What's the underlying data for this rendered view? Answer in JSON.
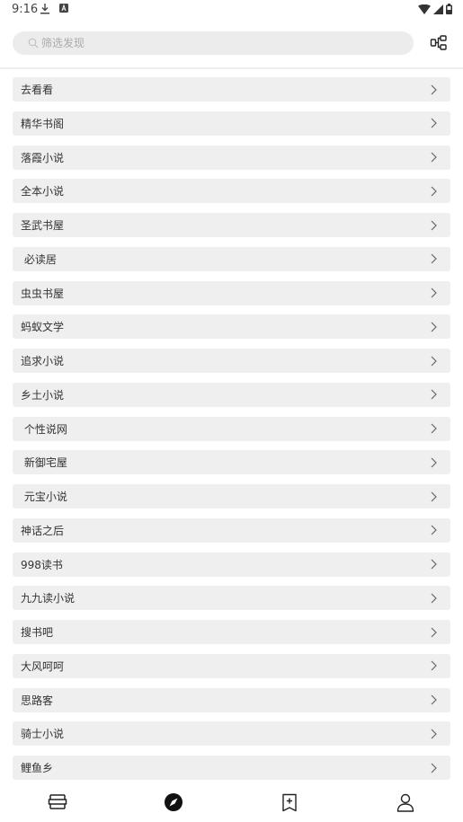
{
  "status_bar": {
    "time": "9:16"
  },
  "search": {
    "placeholder": "筛选发现"
  },
  "sources": [
    {
      "label": "去看看"
    },
    {
      "label": "精华书阁"
    },
    {
      "label": "落霞小说"
    },
    {
      "label": "全本小说"
    },
    {
      "label": "圣武书屋"
    },
    {
      "label": " 必读居"
    },
    {
      "label": "虫虫书屋"
    },
    {
      "label": "蚂蚁文学"
    },
    {
      "label": "追求小说"
    },
    {
      "label": "乡土小说"
    },
    {
      "label": " 个性说网"
    },
    {
      "label": " 新御宅屋"
    },
    {
      "label": " 元宝小说"
    },
    {
      "label": "神话之后"
    },
    {
      "label": "998读书"
    },
    {
      "label": "九九读小说"
    },
    {
      "label": "搜书吧"
    },
    {
      "label": "大风呵呵"
    },
    {
      "label": "思路客"
    },
    {
      "label": "骑士小说"
    },
    {
      "label": "鲤鱼乡"
    }
  ],
  "bottom_nav": [
    "bookshelf-icon",
    "discover-icon",
    "rss-icon",
    "profile-icon"
  ],
  "colors": {
    "row_bg": "#efefef",
    "search_bg": "#ececec",
    "icon": "#222222"
  }
}
